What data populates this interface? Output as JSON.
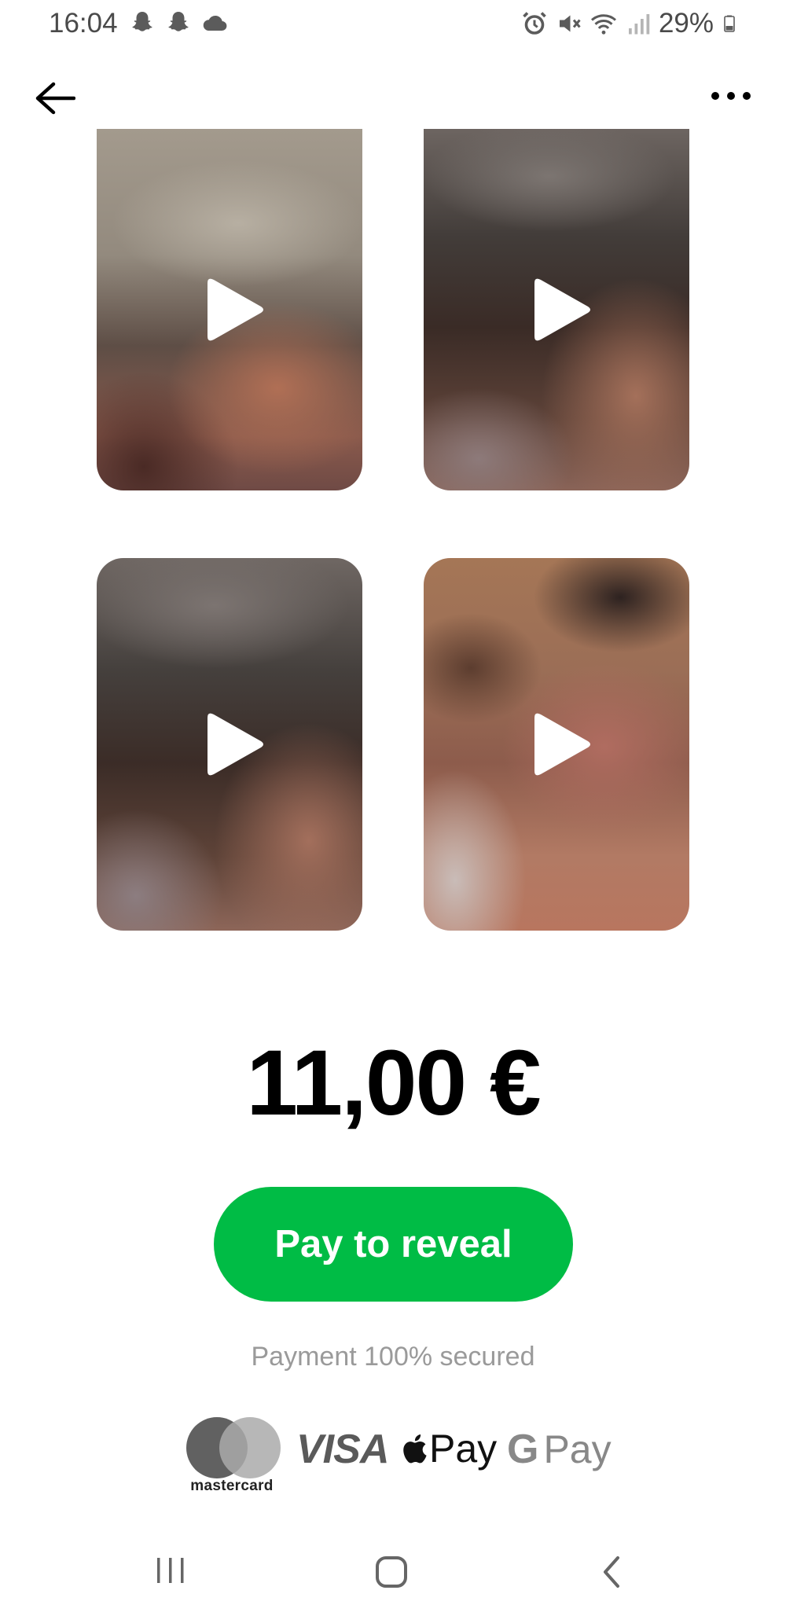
{
  "status_bar": {
    "time": "16:04",
    "left_icons": [
      "snapchat-icon",
      "snapchat-icon",
      "cloud-icon"
    ],
    "right_icons": [
      "alarm-icon",
      "mute-icon",
      "wifi-icon",
      "signal-icon",
      "battery-icon"
    ],
    "battery": "29%"
  },
  "app_bar": {
    "back_icon": "arrow-left-icon",
    "more_icon": "more-horizontal-icon"
  },
  "media": {
    "items": [
      {
        "type": "video",
        "locked": true
      },
      {
        "type": "video",
        "locked": true
      },
      {
        "type": "video",
        "locked": true
      },
      {
        "type": "video",
        "locked": true
      }
    ]
  },
  "purchase": {
    "price": "11,00 €",
    "button_label": "Pay to reveal",
    "secure_text": "Payment 100% secured",
    "button_color": "#00bc45"
  },
  "payment_methods": {
    "mastercard": "mastercard",
    "visa": "VISA",
    "apple_pay": "Pay",
    "google_pay_g": "G",
    "google_pay": "Pay"
  },
  "nav_bar": {
    "buttons": [
      "recents-icon",
      "home-icon",
      "back-icon"
    ]
  }
}
